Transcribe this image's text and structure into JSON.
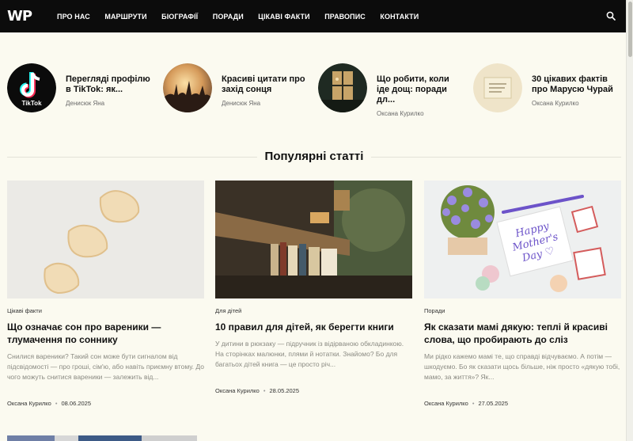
{
  "header": {
    "logo": "WP",
    "nav": [
      "ПРО НАС",
      "МАРШРУТИ",
      "БІОГРАФІЇ",
      "ПОРАДИ",
      "ЦІКАВІ ФАКТИ",
      "ПРАВОПИС",
      "КОНТАКТИ"
    ],
    "search_icon": "search-icon"
  },
  "featured": [
    {
      "title": "Переглядi профілю в TikTok: як...",
      "author": "Денисюк Яна",
      "thumb": "tiktok-logo"
    },
    {
      "title": "Красиві цитати про захід сонця",
      "author": "Денисюк Яна",
      "thumb": "sunset-crowd"
    },
    {
      "title": "Що робити, коли іде дощ: поради дл...",
      "author": "Оксана Курилко",
      "thumb": "rainy-window"
    },
    {
      "title": "30 цікавих фактів про Марусю Чурай",
      "author": "Оксана Курилко",
      "thumb": "book-cover"
    }
  ],
  "section_title": "Популярні статті",
  "cards": [
    {
      "category": "Цікаві факти",
      "title": "Що означає сон про вареники — тлумачення по соннику",
      "excerpt": "Снилися вареники? Такий сон може бути сигналом від підсвідомості — про гроші, сім'ю, або навіть приємну втому. До чого можуть снитися вареники — залежить від...",
      "author": "Оксана Курилко",
      "date": "08.06.2025"
    },
    {
      "category": "Для дітей",
      "title": "10 правил для дітей, як берегти книги",
      "excerpt": "У дитини в рюкзаку — підручник із відірваною обкладинкою. На сторінках малюнки, плями й нотатки. Знайомо? Бо для багатьох дітей книга — це просто річ...",
      "author": "Оксана Курилко",
      "date": "28.05.2025"
    },
    {
      "category": "Поради",
      "title": "Як сказати мамі дякую: теплі й красиві слова, що пробирають до сліз",
      "excerpt": "Ми рідко кажемо мамі те, що справді відчуваємо. А потім — шкодуємо. Бо як сказати щось більше, ніж просто «дякую тобі, мамо, за життя»? Як...",
      "author": "Оксана Курилко",
      "date": "27.05.2025"
    }
  ],
  "card3_image_text": "Happy Mother's Day",
  "colors": {
    "header_bg": "#0c0c0c",
    "page_bg": "#fbfaf0",
    "accent": "#111111"
  }
}
